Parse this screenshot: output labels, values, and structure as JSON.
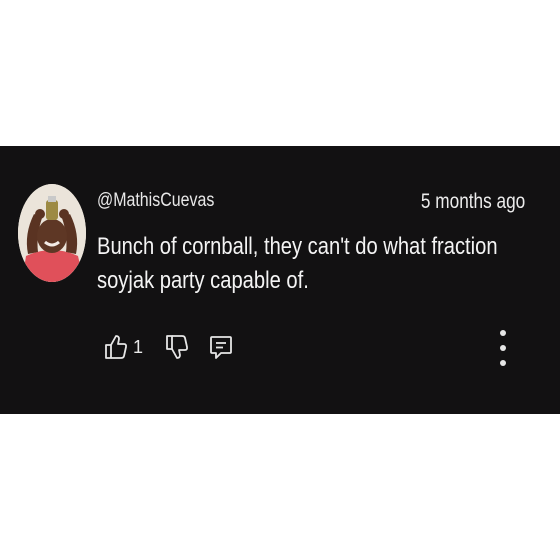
{
  "comment": {
    "username": "@MathisCuevas",
    "timestamp": "5 months ago",
    "text_line_1": "Bunch of cornball, they can't do what fraction",
    "text_line_2": "soyjak party capable of.",
    "like_count": "1",
    "avatar_icon": "user-avatar-photo"
  },
  "icons": {
    "like": "thumbs-up-icon",
    "dislike": "thumbs-down-icon",
    "reply": "comment-reply-icon",
    "more": "more-vertical-icon"
  },
  "colors": {
    "background": "#121112",
    "text": "#f1f1f1",
    "page": "#ffffff"
  }
}
